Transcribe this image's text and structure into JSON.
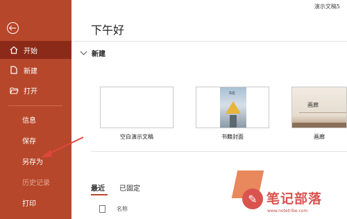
{
  "window": {
    "doc_title": "演示文稿5"
  },
  "sidebar": {
    "back_icon": "back-arrow-icon",
    "items": [
      {
        "label": "开始",
        "icon": "home-icon"
      },
      {
        "label": "新建",
        "icon": "new-file-icon"
      },
      {
        "label": "打开",
        "icon": "folder-open-icon"
      },
      {
        "label": "信息"
      },
      {
        "label": "保存"
      },
      {
        "label": "另存为"
      },
      {
        "label": "历史记录"
      },
      {
        "label": "打印"
      }
    ]
  },
  "main": {
    "greeting": "下午好",
    "new_section_label": "新建",
    "templates": [
      {
        "label": "空白演示文稿"
      },
      {
        "label": "书籍封面",
        "thumb_text": "书名"
      },
      {
        "label": "画廊",
        "thumb_text": "画廊"
      }
    ],
    "tabs": [
      {
        "label": "最近"
      },
      {
        "label": "已固定"
      }
    ],
    "list_header_name": "名称"
  },
  "watermark": {
    "text": "笔记部落",
    "url": "www.notetribe.com"
  },
  "colors": {
    "accent": "#b7472a",
    "sidebar_active": "#8c2a1a",
    "annotation_arrow": "#e0463c"
  }
}
